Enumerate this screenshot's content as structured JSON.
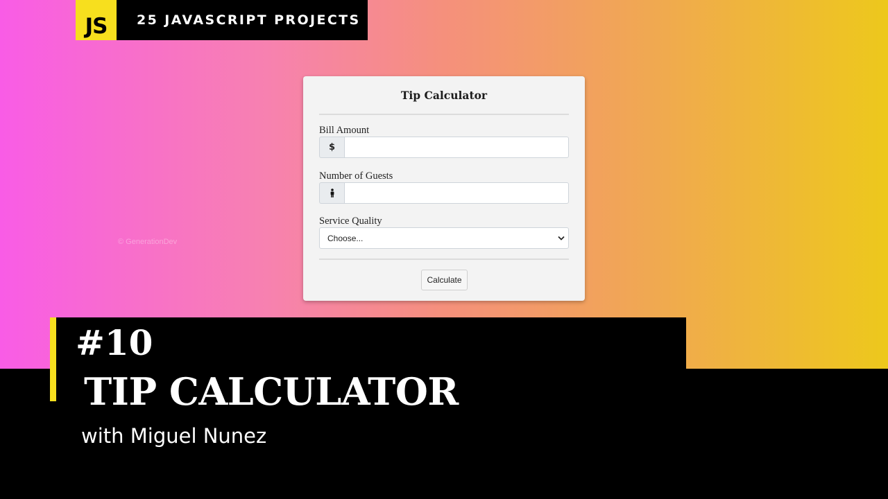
{
  "banner": {
    "logo_text": "JS",
    "series_title": "25 JAVASCRIPT PROJECTS"
  },
  "watermark": {
    "text": "© GenerationDev"
  },
  "calculator": {
    "title": "Tip Calculator",
    "bill": {
      "label": "Bill Amount",
      "addon": "$",
      "value": ""
    },
    "guests": {
      "label": "Number of Guests",
      "addon_icon": "person-icon",
      "value": ""
    },
    "service": {
      "label": "Service Quality",
      "selected": "Choose..."
    },
    "button_label": "Calculate"
  },
  "thumbnail": {
    "episode": "#10",
    "title": "TIP CALCULATOR",
    "author": "with Miguel Nunez"
  },
  "colors": {
    "js_yellow": "#f7df1e",
    "gradient_start": "#f95ce6",
    "gradient_end": "#edc81c"
  }
}
